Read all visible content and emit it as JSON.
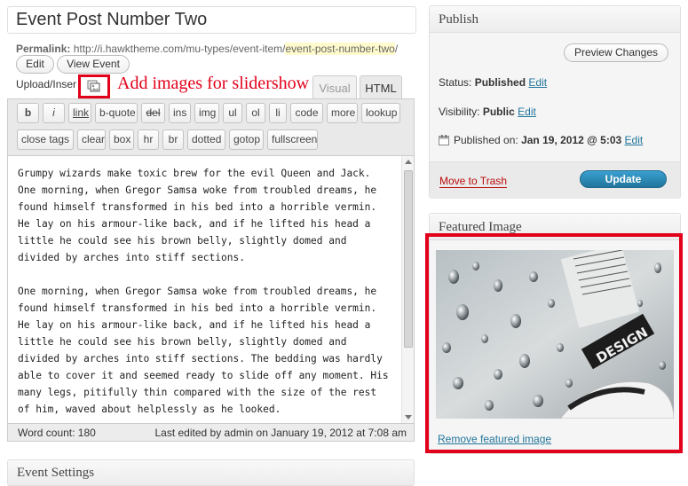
{
  "post": {
    "title": "Event Post Number Two",
    "permalink_label": "Permalink:",
    "permalink_base": "http://i.hawktheme.com/mu-types/event-item/",
    "permalink_slug": "event-post-number-two",
    "permalink_trail": "/",
    "edit_label": "Edit",
    "view_label": "View Event"
  },
  "media": {
    "upload_label": "Upload/Inser",
    "icon": "media-gallery-icon",
    "annotation": "Add images for slidershow"
  },
  "editor": {
    "tabs": [
      "Visual",
      "HTML"
    ],
    "active_tab": "HTML",
    "toolbar_row1": [
      "b",
      "i",
      "link",
      "b-quote",
      "del",
      "ins",
      "img",
      "ul",
      "ol",
      "li",
      "code",
      "more",
      "lookup"
    ],
    "toolbar_row2": [
      "close tags",
      "clear",
      "box",
      "hr",
      "br",
      "dotted",
      "gotop",
      "fullscreen"
    ],
    "paragraphs": [
      "Grumpy wizards make toxic brew for the evil Queen and Jack.\nOne morning, when Gregor Samsa woke from troubled dreams, he\nfound himself transformed in his bed into a horrible vermin.\nHe lay on his armour-like back, and if he lifted his head a\nlittle he could see his brown belly, slightly domed and\ndivided by arches into stiff sections.",
      "One morning, when Gregor Samsa woke from troubled dreams, he\nfound himself transformed in his bed into a horrible vermin.\nHe lay on his armour-like back, and if he lifted his head a\nlittle he could see his brown belly, slightly domed and\ndivided by arches into stiff sections. The bedding was hardly\nable to cover it and seemed ready to slide off any moment. His\nmany legs, pitifully thin compared with the size of the rest\nof him, waved about helplessly as he looked."
    ],
    "word_count": "Word count: 180",
    "last_edited": "Last edited by admin on January 19, 2012 at 7:08 am"
  },
  "event_settings": {
    "title": "Event Settings"
  },
  "publish": {
    "title": "Publish",
    "preview_label": "Preview Changes",
    "status_label": "Status:",
    "status_value": "Published",
    "visibility_label": "Visibility:",
    "visibility_value": "Public",
    "published_label": "Published on:",
    "published_value": "Jan 19, 2012 @ 5:03",
    "edit_label": "Edit",
    "trash_label": "Move to Trash",
    "update_label": "Update"
  },
  "featured": {
    "title": "Featured Image",
    "remove_label": "Remove featured image",
    "image_text": "DESIGN"
  },
  "colors": {
    "annotation_red": "#e2001a",
    "link_blue": "#21759b",
    "trash_red": "#bc0b0b",
    "slug_highlight": "#fffbcc"
  }
}
